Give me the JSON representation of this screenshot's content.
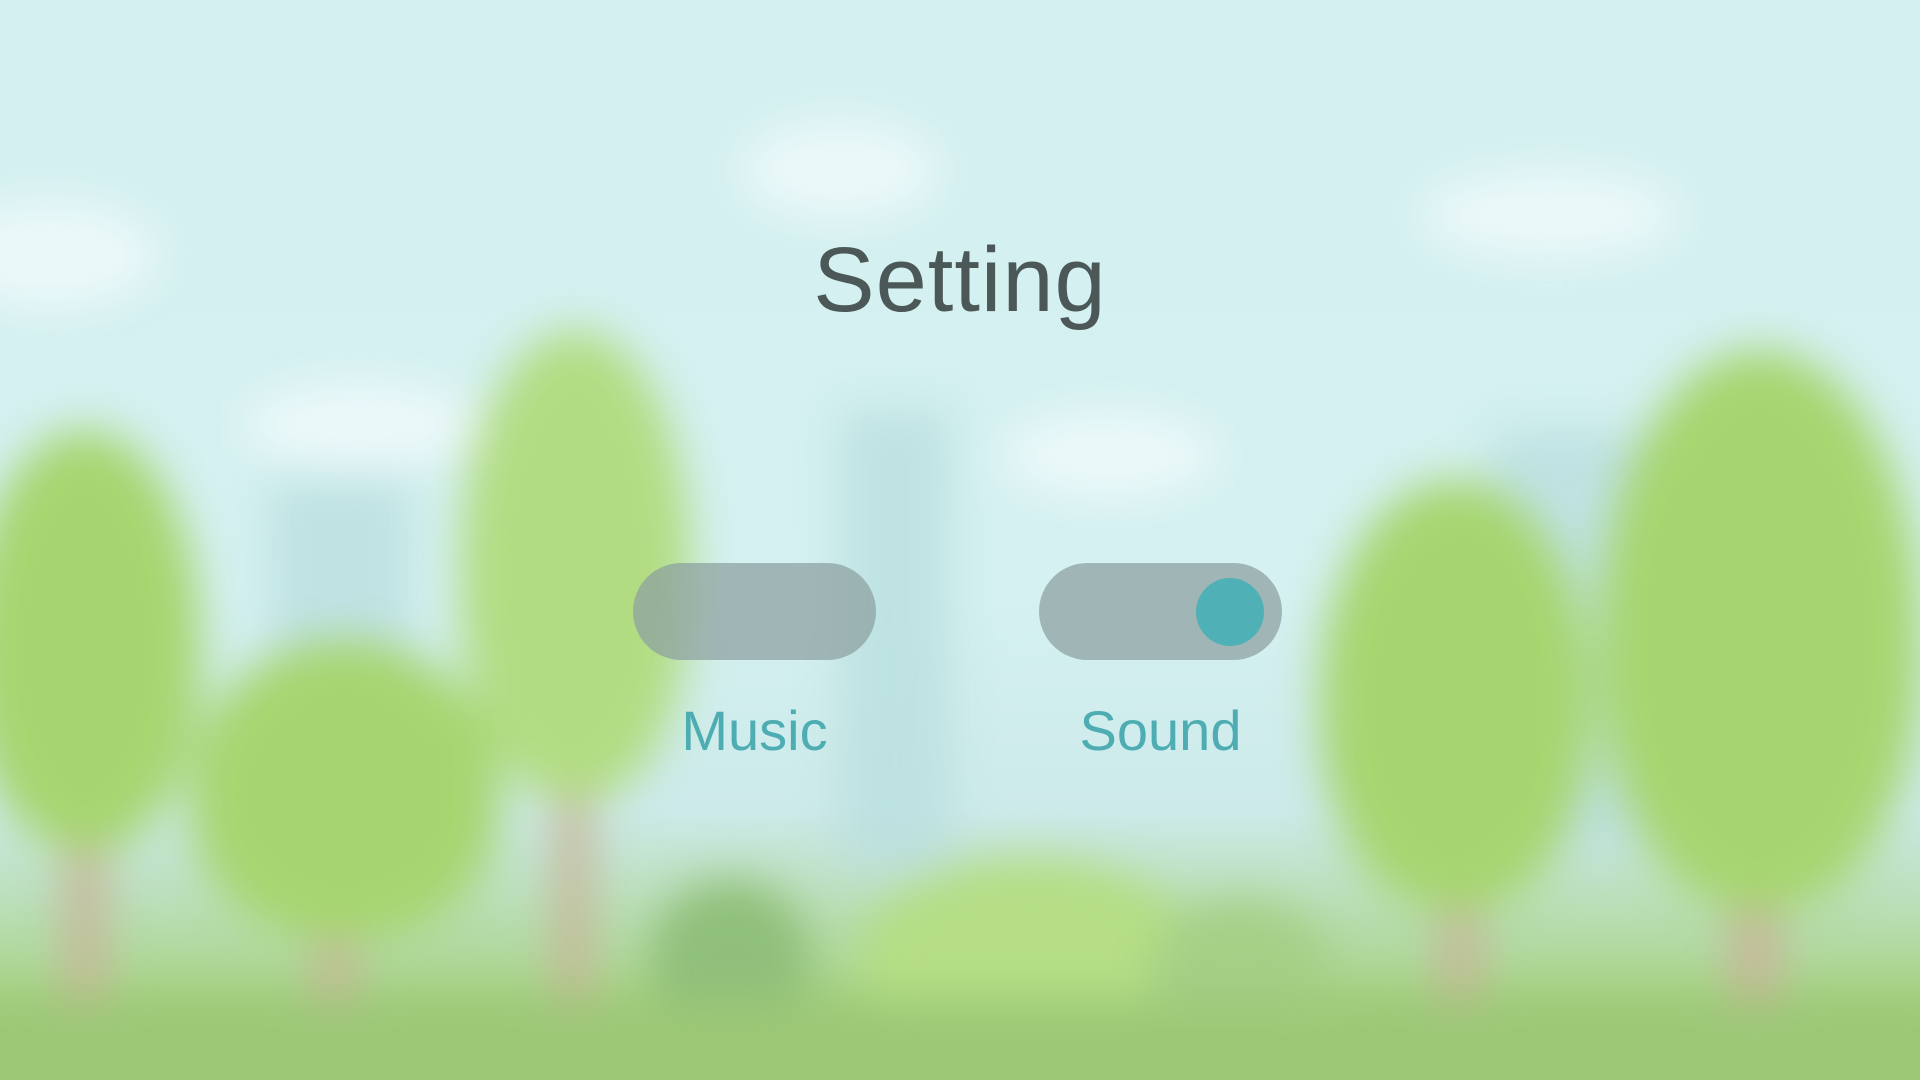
{
  "screen": {
    "title": "Setting"
  },
  "settings": [
    {
      "label": "Music",
      "enabled": false
    },
    {
      "label": "Sound",
      "enabled": true
    }
  ],
  "colors": {
    "title": "#4b5857",
    "label": "#4eadb3",
    "toggle_track": "#8ca0a0",
    "toggle_knob": "#4fb0b5",
    "sky": "#d4f0f0",
    "foliage": "#a6d56f",
    "ground": "#9cc876"
  }
}
